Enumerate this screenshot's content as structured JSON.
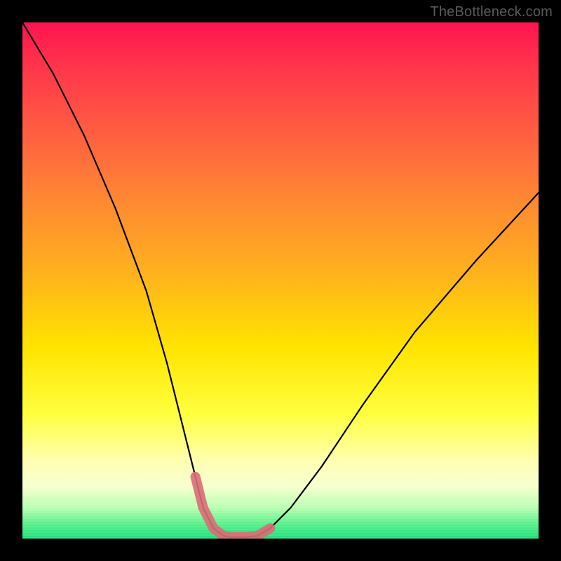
{
  "watermark": "TheBottleneck.com",
  "chart_data": {
    "type": "line",
    "title": "",
    "xlabel": "",
    "ylabel": "",
    "xlim": [
      0,
      100
    ],
    "ylim": [
      0,
      100
    ],
    "grid": false,
    "legend": false,
    "series": [
      {
        "name": "bottleneck-curve",
        "x": [
          0,
          6,
          12,
          18,
          24,
          28,
          31,
          33.5,
          35,
          37,
          39,
          40.5,
          43,
          45.5,
          48,
          52,
          58,
          66,
          76,
          88,
          100
        ],
        "values": [
          100,
          90,
          78,
          64,
          48,
          34,
          22,
          12,
          6,
          2,
          0.5,
          0.3,
          0.3,
          0.5,
          2,
          6,
          14,
          26,
          40,
          54,
          67
        ]
      }
    ],
    "highlight": {
      "name": "optimal-zone",
      "x": [
        33.5,
        35,
        37,
        39,
        40.5,
        43,
        45.5,
        48
      ],
      "values": [
        12,
        6,
        2,
        0.5,
        0.3,
        0.3,
        0.5,
        2
      ]
    },
    "background": {
      "type": "vertical-gradient",
      "stops": [
        {
          "pos": 0,
          "color": "#ff1450"
        },
        {
          "pos": 0.5,
          "color": "#ffb01e"
        },
        {
          "pos": 0.8,
          "color": "#ffff60"
        },
        {
          "pos": 1.0,
          "color": "#1adf7a"
        }
      ]
    }
  }
}
